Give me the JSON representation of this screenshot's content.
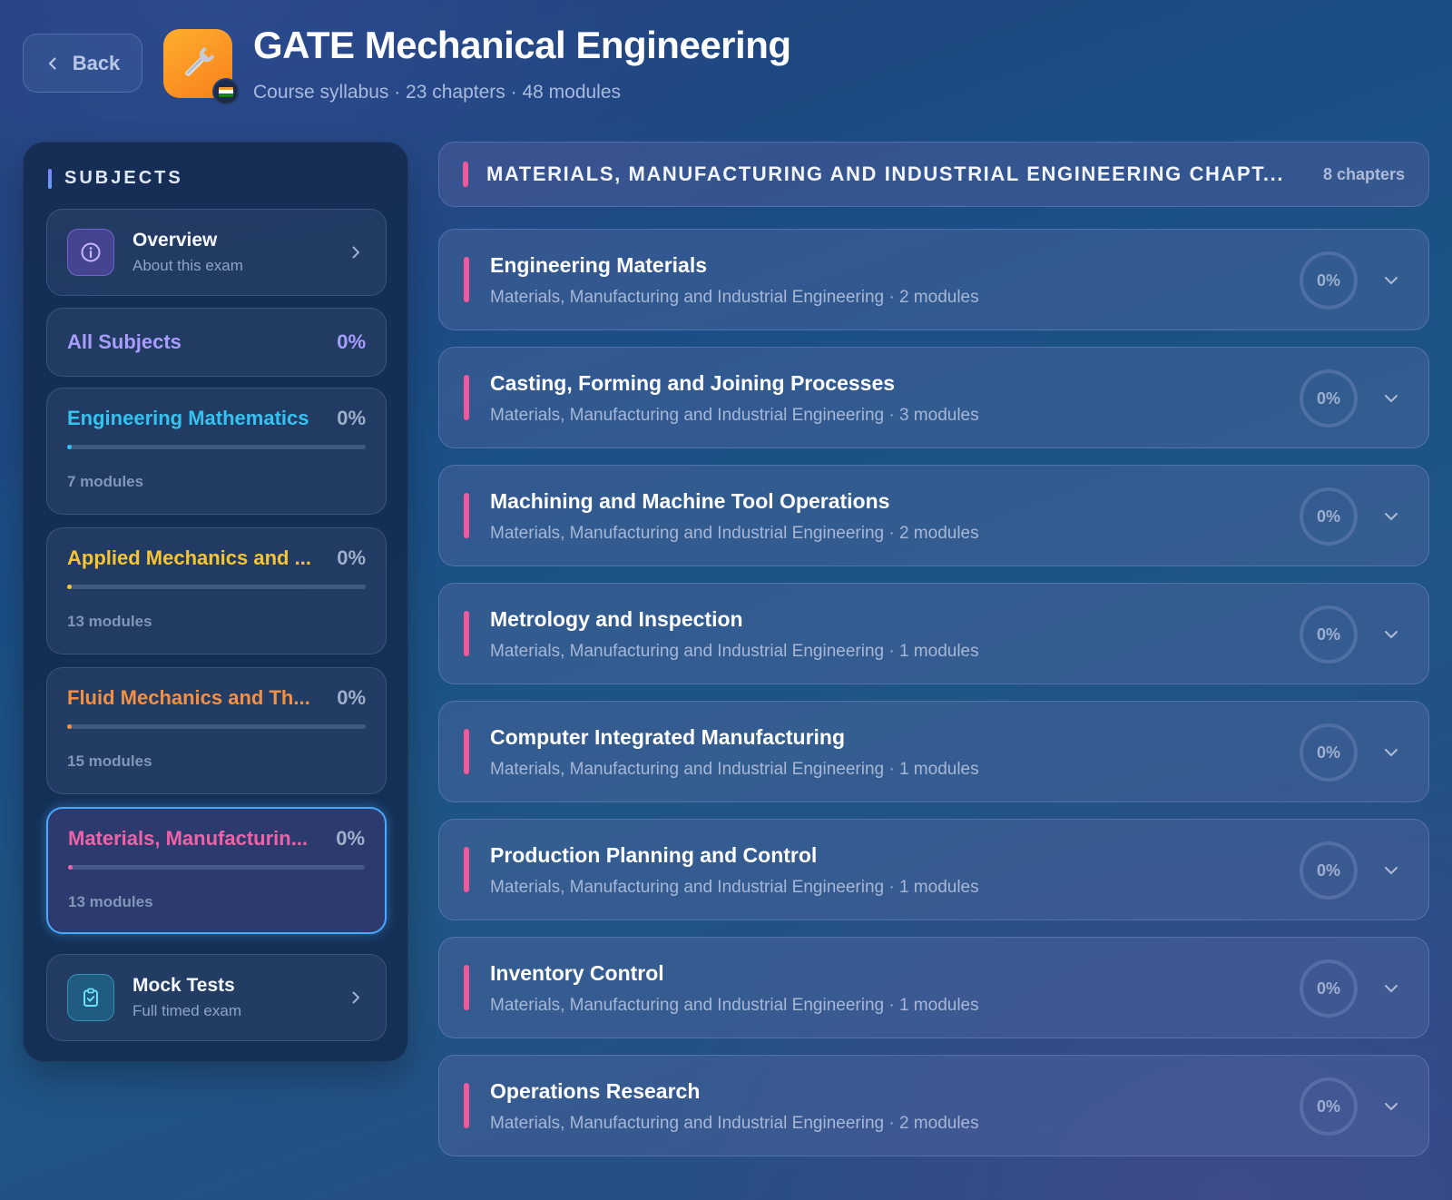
{
  "header": {
    "back_label": "Back",
    "title": "GATE Mechanical Engineering",
    "subtitle": "Course syllabus · 23 chapters · 48 modules",
    "app_icon": "wrench-icon",
    "flag_icon": "india-flag-icon"
  },
  "sidebar": {
    "heading": "SUBJECTS",
    "overview": {
      "title": "Overview",
      "subtitle": "About this exam",
      "icon": "info-icon"
    },
    "all_subjects": {
      "label": "All Subjects",
      "percent": "0%"
    },
    "subjects": [
      {
        "name": "Engineering Mathematics",
        "percent": "0%",
        "progress": 0,
        "modules": "7 modules",
        "color": "#34c3f0",
        "active": false
      },
      {
        "name": "Applied Mechanics and ...",
        "percent": "0%",
        "progress": 0,
        "modules": "13 modules",
        "color": "#f7c531",
        "active": false
      },
      {
        "name": "Fluid Mechanics and Th...",
        "percent": "0%",
        "progress": 0,
        "modules": "15 modules",
        "color": "#f59042",
        "active": false
      },
      {
        "name": "Materials, Manufacturin...",
        "percent": "0%",
        "progress": 0,
        "modules": "13 modules",
        "color": "#f062a8",
        "active": true
      }
    ],
    "mock_tests": {
      "title": "Mock Tests",
      "subtitle": "Full timed exam",
      "icon": "clipboard-check-icon"
    }
  },
  "main": {
    "section_title": "MATERIALS, MANUFACTURING AND INDUSTRIAL ENGINEERING CHAPT...",
    "section_count": "8 chapters",
    "accent_color": "#f05a9c",
    "chapters": [
      {
        "name": "Engineering Materials",
        "meta": "Materials, Manufacturing and Industrial Engineering · 2 modules",
        "percent": "0%"
      },
      {
        "name": "Casting, Forming and Joining Processes",
        "meta": "Materials, Manufacturing and Industrial Engineering · 3 modules",
        "percent": "0%"
      },
      {
        "name": "Machining and Machine Tool Operations",
        "meta": "Materials, Manufacturing and Industrial Engineering · 2 modules",
        "percent": "0%"
      },
      {
        "name": "Metrology and Inspection",
        "meta": "Materials, Manufacturing and Industrial Engineering · 1 modules",
        "percent": "0%"
      },
      {
        "name": "Computer Integrated Manufacturing",
        "meta": "Materials, Manufacturing and Industrial Engineering · 1 modules",
        "percent": "0%"
      },
      {
        "name": "Production Planning and Control",
        "meta": "Materials, Manufacturing and Industrial Engineering · 1 modules",
        "percent": "0%"
      },
      {
        "name": "Inventory Control",
        "meta": "Materials, Manufacturing and Industrial Engineering · 1 modules",
        "percent": "0%"
      },
      {
        "name": "Operations Research",
        "meta": "Materials, Manufacturing and Industrial Engineering · 2 modules",
        "percent": "0%"
      }
    ]
  }
}
